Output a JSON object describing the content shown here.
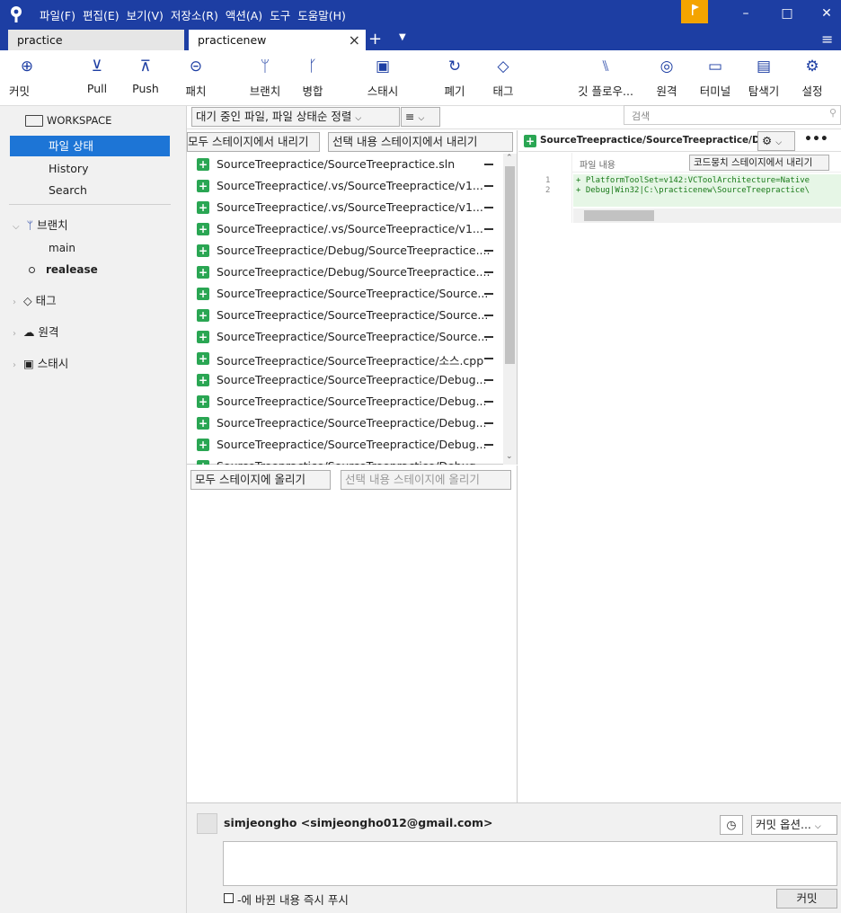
{
  "menu": [
    "파일(F)",
    "편집(E)",
    "보기(V)",
    "저장소(R)",
    "액션(A)",
    "도구",
    "도움말(H)"
  ],
  "tabs": [
    {
      "label": "practice"
    },
    {
      "label": "practicenew"
    }
  ],
  "toolbar": {
    "commit": "커밋",
    "pull": "Pull",
    "push": "Push",
    "patch": "패치",
    "branch": "브랜치",
    "merge": "병합",
    "stash": "스태시",
    "discard": "폐기",
    "tag": "태그",
    "gitflow": "깃 플로우...",
    "remote": "원격",
    "terminal": "터미널",
    "explorer": "탐색기",
    "settings": "설정"
  },
  "sidebar": {
    "workspace": "WORKSPACE",
    "file_status": "파일 상태",
    "history": "History",
    "search": "Search",
    "branches": "브랜치",
    "branch_items": [
      "main",
      "realease"
    ],
    "tags": "태그",
    "remotes": "원격",
    "stashes": "스태시"
  },
  "main": {
    "sort_dropdown": "대기 중인 파일, 파일 상태순 정렬",
    "search_placeholder": "검색",
    "unstage_all": "모두 스테이지에서 내리기",
    "unstage_selected": "선택 내용 스테이지에서 내리기",
    "stage_all": "모두 스테이지에 올리기",
    "stage_selected": "선택 내용 스테이지에 올리기",
    "staged_files": [
      "SourceTreepractice/SourceTreepractice.sln",
      "SourceTreepractice/.vs/SourceTreepractice/v1...",
      "SourceTreepractice/.vs/SourceTreepractice/v1...",
      "SourceTreepractice/.vs/SourceTreepractice/v1...",
      "SourceTreepractice/Debug/SourceTreepractice....",
      "SourceTreepractice/Debug/SourceTreepractice....",
      "SourceTreepractice/SourceTreepractice/Source...",
      "SourceTreepractice/SourceTreepractice/Source...",
      "SourceTreepractice/SourceTreepractice/Source...",
      "SourceTreepractice/SourceTreepractice/소스.cpp",
      "SourceTreepractice/SourceTreepractice/Debug...",
      "SourceTreepractice/SourceTreepractice/Debug...",
      "SourceTreepractice/SourceTreepractice/Debug...",
      "SourceTreepractice/SourceTreepractice/Debug...",
      "SourceTreepractice/SourceTreepractice/Debug..."
    ]
  },
  "diff": {
    "filename": "SourceTreepractice/SourceTreepractice/Debu...",
    "header": "파일 내용",
    "unstage_hunk": "코드뭉치 스테이지에서 내리기",
    "lines": [
      {
        "num": "1",
        "text": "+ PlatformToolSet=v142:VCToolArchitecture=Native"
      },
      {
        "num": "2",
        "text": "+ Debug|Win32|C:\\practicenew\\SourceTreepractice\\"
      }
    ]
  },
  "commit": {
    "author": "simjeongho <simjeongho012@gmail.com>",
    "options": "커밋 옵션...",
    "push_option": "-에 바뀐 내용 즉시 푸시",
    "commit_button": "커밋"
  }
}
